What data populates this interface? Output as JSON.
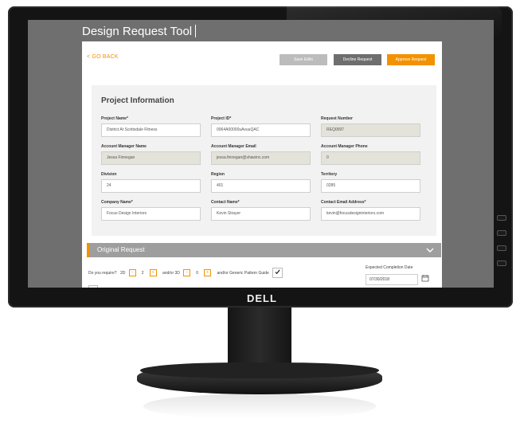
{
  "app": {
    "title": "Design Request Tool"
  },
  "nav": {
    "go_back": "< GO BACK"
  },
  "actions": {
    "save": "Save Edits",
    "decline": "Decline Request",
    "approve": "Approve Request"
  },
  "project_info": {
    "title": "Project Information",
    "fields": [
      {
        "label": "Project Name*",
        "value": "District At Scottsdale Fitness",
        "readonly": false
      },
      {
        "label": "Project ID*",
        "value": "0064A00000uAvuuQAC",
        "readonly": false
      },
      {
        "label": "Request Number",
        "value": "REQ0097",
        "readonly": true
      },
      {
        "label": "Account Manager Name",
        "value": "Jessa Finnegan",
        "readonly": true
      },
      {
        "label": "Account Manager Email",
        "value": "jessa.finnegan@shawinc.com",
        "readonly": true
      },
      {
        "label": "Account Manager Phone",
        "value": "0",
        "readonly": true
      },
      {
        "label": "Division",
        "value": "24",
        "readonly": false
      },
      {
        "label": "Region",
        "value": "401",
        "readonly": false
      },
      {
        "label": "Territory",
        "value": "0285",
        "readonly": false
      },
      {
        "label": "Company Name*",
        "value": "Focus Design Interiors",
        "readonly": false
      },
      {
        "label": "Contact Name*",
        "value": "Kevin Strayer",
        "readonly": false
      },
      {
        "label": "Contact Email Address*",
        "value": "kevin@focusdesigninteriors.com",
        "readonly": false
      }
    ]
  },
  "original_request": {
    "title": "Original Request",
    "question": "Do you require?",
    "two_d_label": "2D",
    "two_d_value": "2",
    "and_or_3d_label": "and/or 3D",
    "three_d_value": "0",
    "generic_label": "and/or Generic Pattern Guide",
    "generic_checked": true,
    "date_label": "Expected Completion Date",
    "date_value": "07/30/2018"
  },
  "monitor": {
    "brand": "DELL"
  },
  "colors": {
    "accent": "#f29200",
    "header_bg": "#6f6f6f",
    "readonly_bg": "#e3e3d9"
  }
}
